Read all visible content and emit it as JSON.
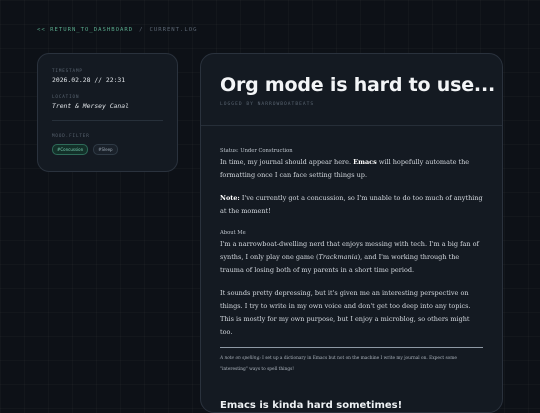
{
  "breadcrumb": {
    "back_label": "<< RETURN_TO_DASHBOARD",
    "separator": "/",
    "current": "CURRENT.LOG"
  },
  "meta": {
    "timestamp_label": "TIMESTAMP",
    "timestamp_value": "2026.02.28 // 22:31",
    "location_label": "LOCATION",
    "location_value": "Trent & Mersey Canal",
    "mood_label": "MOOD.FILTER",
    "tags": [
      "#Concussion",
      "#Sleep"
    ]
  },
  "article": {
    "title": "Org mode is hard to use...",
    "logged_by": "LOGGED BY NARROWBOATBEATS",
    "status_label": "Status: Under Construction",
    "p1_a": "In time, my journal should appear here. ",
    "p1_bold": "Emacs",
    "p1_b": " will hopefully automate the formatting once I can face setting things up.",
    "p2_bold": "Note:",
    "p2_rest": " I've currently got a concussion, so I'm unable to do too much of anything at the moment!",
    "about_label": "About Me",
    "p3_a": "I'm a narrowboat-dwelling nerd that enjoys messing with tech. I'm a big fan of synths, I only play one game (",
    "p3_italic": "Trackmania",
    "p3_b": "), and I'm working through the trauma of losing both of my parents in a short time period.",
    "p4": "It sounds pretty depressing, but it's given me an interesting perspective on things. I try to write in my own voice and don't get too deep into any topics. This is mostly for my own purpose, but I enjoy a microblog, so others might too.",
    "note_italic": "A note on spelling:",
    "note_rest": " I set up a dictionary in Emacs but not on the machine I write my journal on. Expect some \"interesting\" ways to spell things!",
    "next_heading": "Emacs is kinda hard sometimes!"
  },
  "colors": {
    "background": "#0d1117",
    "card": "#141a22",
    "accent": "#58a98b"
  }
}
